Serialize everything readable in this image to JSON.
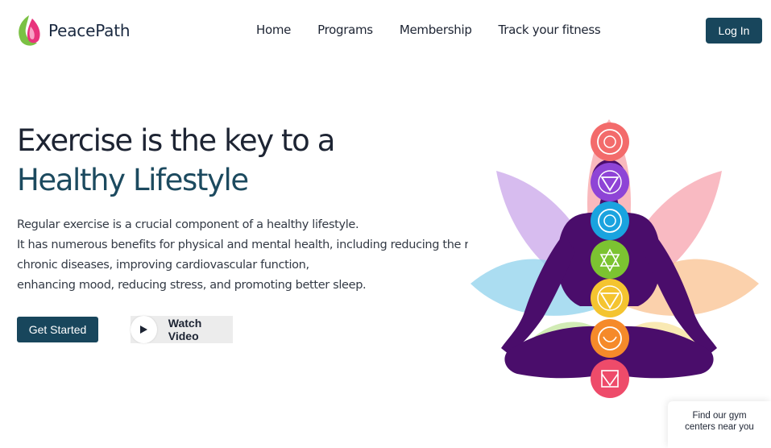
{
  "brand": {
    "name": "PeacePath",
    "leaf_primary": "#7bc144",
    "leaf_accent": "#e8337c"
  },
  "nav": {
    "items": [
      {
        "id": "home",
        "label": "Home"
      },
      {
        "id": "programs",
        "label": "Programs"
      },
      {
        "id": "membership",
        "label": "Membership"
      },
      {
        "id": "track",
        "label": "Track your fitness"
      }
    ],
    "login_label": "Log In"
  },
  "hero": {
    "title_line1": "Exercise is the key to a",
    "title_line2": "Healthy Lifestyle",
    "description_lines": [
      "Regular exercise is a crucial component of a healthy lifestyle.",
      "It has numerous benefits for physical and mental health, including reducing the risk o",
      "chronic diseases, improving cardiovascular function,",
      "enhancing mood, reducing stress, and promoting better sleep."
    ],
    "primary_cta": "Get Started",
    "secondary_cta": "Watch Video"
  },
  "illustration": {
    "icon": "meditation-chakra-illustration",
    "chakra_colors": [
      "#f36b6b",
      "#8e44d6",
      "#1aa3df",
      "#7cc331",
      "#f4c430",
      "#f58a2a",
      "#ee4b6a"
    ],
    "figure_color": "#4a0d6b"
  },
  "gym_locator": {
    "line1": "Find our gym",
    "line2": "centers near you"
  },
  "colors": {
    "primary": "#18465c",
    "heading": "#1d2433",
    "heading_accent": "#1c4a5f"
  }
}
